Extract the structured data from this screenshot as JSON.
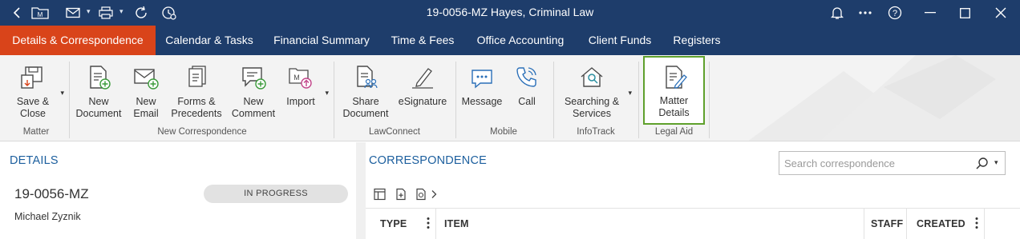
{
  "window": {
    "title": "19-0056-MZ Hayes, Criminal Law",
    "icons": [
      "back-arrow-icon",
      "matter-folder-icon",
      "mail-icon",
      "print-icon",
      "refresh-icon",
      "history-icon",
      "bell-icon",
      "more-icon",
      "help-icon",
      "minimize-icon",
      "maximize-icon",
      "close-icon"
    ],
    "folder_badge": "M"
  },
  "tabs": [
    {
      "label": "Details & Correspondence",
      "active": true
    },
    {
      "label": "Calendar & Tasks"
    },
    {
      "label": "Financial Summary"
    },
    {
      "label": "Time & Fees"
    },
    {
      "label": "Office Accounting"
    },
    {
      "label": "Client Funds"
    },
    {
      "label": "Registers"
    }
  ],
  "ribbon": {
    "groups": {
      "matter": "Matter",
      "new_correspondence": "New Correspondence",
      "lawconnect": "LawConnect",
      "mobile": "Mobile",
      "infotrack": "InfoTrack",
      "legal_aid": "Legal Aid"
    },
    "buttons": {
      "save_close": "Save &\nClose",
      "new_document": "New\nDocument",
      "new_email": "New\nEmail",
      "forms_precedents": "Forms &\nPrecedents",
      "new_comment": "New\nComment",
      "import": "Import",
      "share_document": "Share\nDocument",
      "esignature": "eSignature",
      "message": "Message",
      "call": "Call",
      "searching_services": "Searching &\nServices",
      "matter_details": "Matter\nDetails"
    }
  },
  "details": {
    "title": "DETAILS",
    "matter_number": "19-0056-MZ",
    "status": "IN PROGRESS",
    "client": "Michael Zyznik"
  },
  "correspondence": {
    "title": "CORRESPONDENCE",
    "search_placeholder": "Search correspondence",
    "columns": [
      "TYPE",
      "ITEM",
      "STAFF",
      "CREATED"
    ]
  },
  "colors": {
    "titlebar": "#1e3d6b",
    "active_tab": "#d9441a",
    "section_title": "#1c5f9e",
    "highlight": "#5fa02c"
  }
}
